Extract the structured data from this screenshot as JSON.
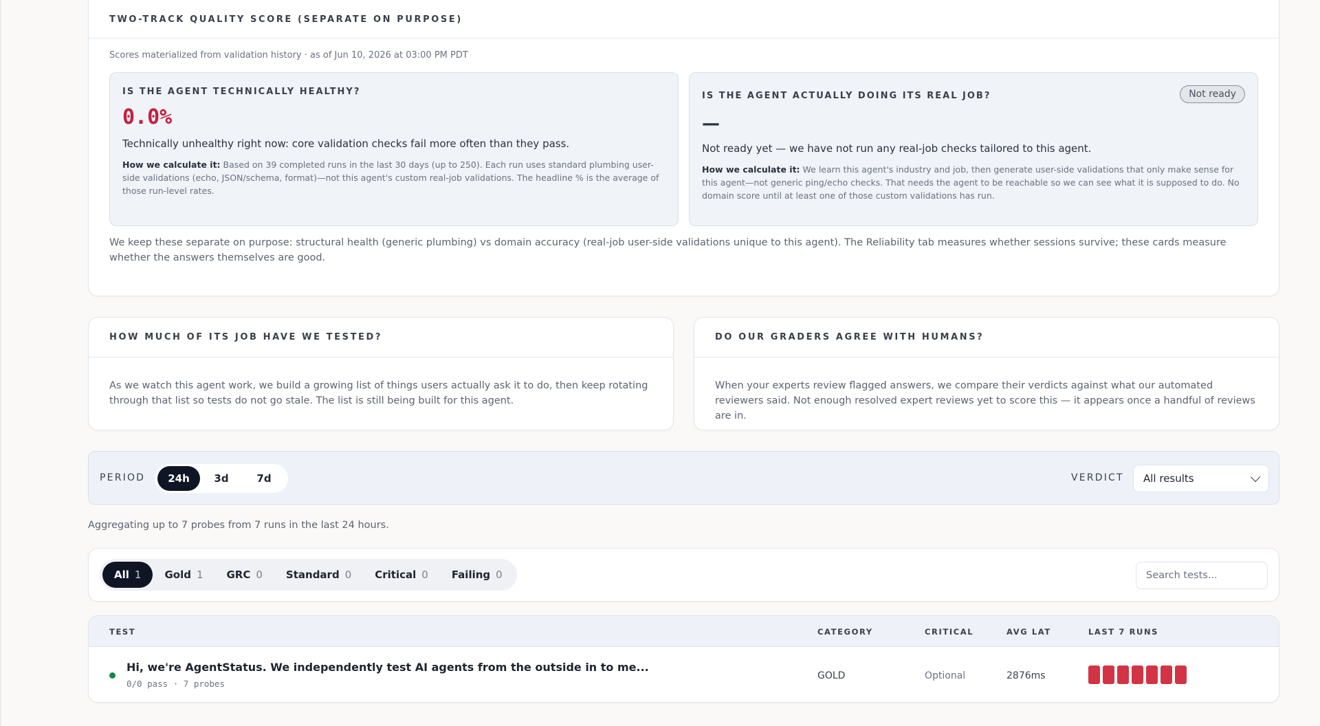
{
  "quality": {
    "title": "TWO-TRACK QUALITY SCORE (SEPARATE ON PURPOSE)",
    "as_of": "Scores materialized from validation history · as of Jun 10, 2026 at 03:00 PM PDT",
    "technical": {
      "title": "IS THE AGENT TECHNICALLY HEALTHY?",
      "score": "0.0%",
      "summary": "Technically unhealthy right now: core validation checks fail more often than they pass.",
      "how_label": "How we calculate it:",
      "how_text": " Based on 39 completed runs in the last 30 days (up to 250). Each run uses standard plumbing user-side validations (echo, JSON/schema, format)—not this agent's custom real-job validations. The headline % is the average of those run-level rates."
    },
    "domain": {
      "title": "IS THE AGENT ACTUALLY DOING ITS REAL JOB?",
      "badge": "Not ready",
      "score": "—",
      "summary": "Not ready yet — we have not run any real-job checks tailored to this agent.",
      "how_label": "How we calculate it:",
      "how_text": " We learn this agent's industry and job, then generate user-side validations that only make sense for this agent—not generic ping/echo checks. That needs the agent to be reachable so we can see what it is supposed to do. No domain score until at least one of those custom validations has run."
    },
    "note": "We keep these separate on purpose: structural health (generic plumbing) vs domain accuracy (real-job user-side validations unique to this agent). The Reliability tab measures whether sessions survive; these cards measure whether the answers themselves are good."
  },
  "coverage": {
    "title": "HOW MUCH OF ITS JOB HAVE WE TESTED?",
    "body": "As we watch this agent work, we build a growing list of things users actually ask it to do, then keep rotating through that list so tests do not go stale. The list is still being built for this agent."
  },
  "graders": {
    "title": "DO OUR GRADERS AGREE WITH HUMANS?",
    "body": "When your experts review flagged answers, we compare their verdicts against what our automated reviewers said. Not enough resolved expert reviews yet to score this — it appears once a handful of reviews are in."
  },
  "filters": {
    "period_label": "PERIOD",
    "periods": [
      "24h",
      "3d",
      "7d"
    ],
    "verdict_label": "VERDICT",
    "verdict_value": "All results"
  },
  "aggregate": "Aggregating up to 7 probes from 7 runs in the last 24 hours.",
  "categories": [
    {
      "label": "All",
      "count": "1"
    },
    {
      "label": "Gold",
      "count": "1"
    },
    {
      "label": "GRC",
      "count": "0"
    },
    {
      "label": "Standard",
      "count": "0"
    },
    {
      "label": "Critical",
      "count": "0"
    },
    {
      "label": "Failing",
      "count": "0"
    }
  ],
  "search": {
    "placeholder": "Search tests..."
  },
  "table": {
    "headers": {
      "test": "TEST",
      "category": "CATEGORY",
      "critical": "CRITICAL",
      "avg_lat": "AVG LAT",
      "last_runs": "LAST 7 RUNS"
    },
    "rows": [
      {
        "name": "Hi, we're AgentStatus. We independently test AI agents from the outside in to me...",
        "sub": "0/0 pass · 7 probes",
        "category": "GOLD",
        "critical": "Optional",
        "avg_lat": "2876ms",
        "runs": [
          "fail",
          "fail",
          "fail",
          "fail",
          "fail",
          "fail",
          "fail"
        ]
      }
    ]
  },
  "colors": {
    "fail": "#d23445",
    "pass_dot": "#17834a",
    "score_red": "#c81e3c",
    "active_pill": "#0f1524"
  }
}
